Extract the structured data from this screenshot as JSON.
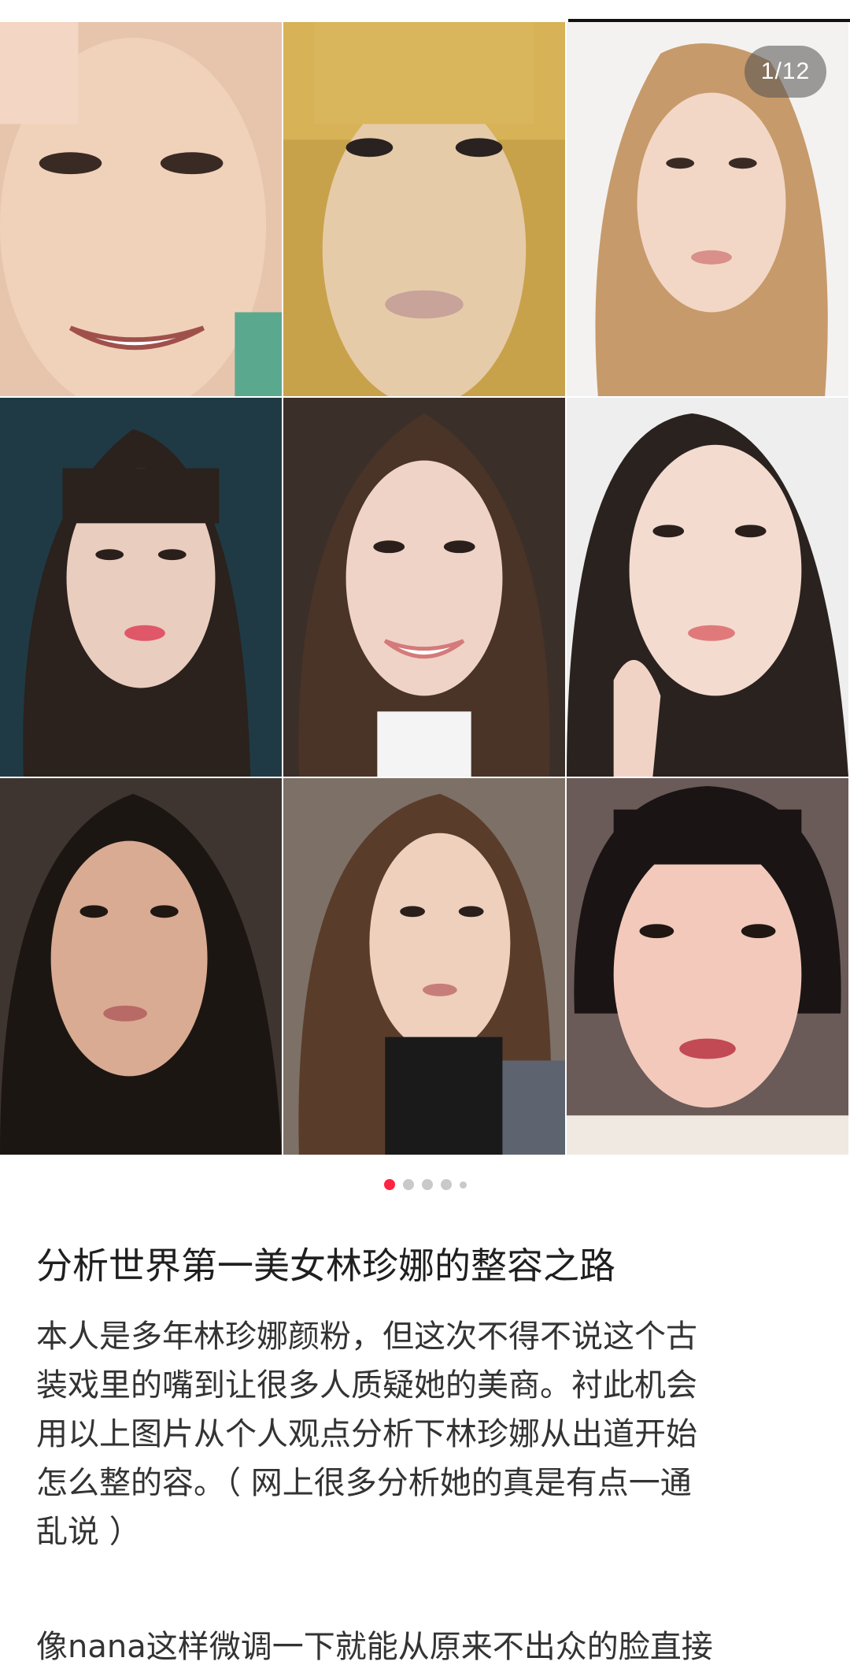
{
  "carousel": {
    "counter": "1/12",
    "current_index": 1,
    "total": 12,
    "photos": [
      {
        "name": "photo-1"
      },
      {
        "name": "photo-2"
      },
      {
        "name": "photo-3"
      },
      {
        "name": "photo-4"
      },
      {
        "name": "photo-5"
      },
      {
        "name": "photo-6"
      },
      {
        "name": "photo-7"
      },
      {
        "name": "photo-8"
      },
      {
        "name": "photo-9"
      }
    ],
    "dot_active_color": "#ff2442",
    "dot_color": "#c9c9c9"
  },
  "note": {
    "title": "分析世界第一美女林珍娜的整容之路",
    "body": "本人是多年林珍娜颜粉，但这次不得不说这个古\n装戏里的嘴到让很多人质疑她的美商。衬此机会\n用以上图片从个人观点分析下林珍娜从出道开始\n怎么整的容。（ 网上很多分析她的真是有点一通\n乱说 ）",
    "body_continued": "像nana这样微调一下就能从原来不出众的脸直接"
  }
}
